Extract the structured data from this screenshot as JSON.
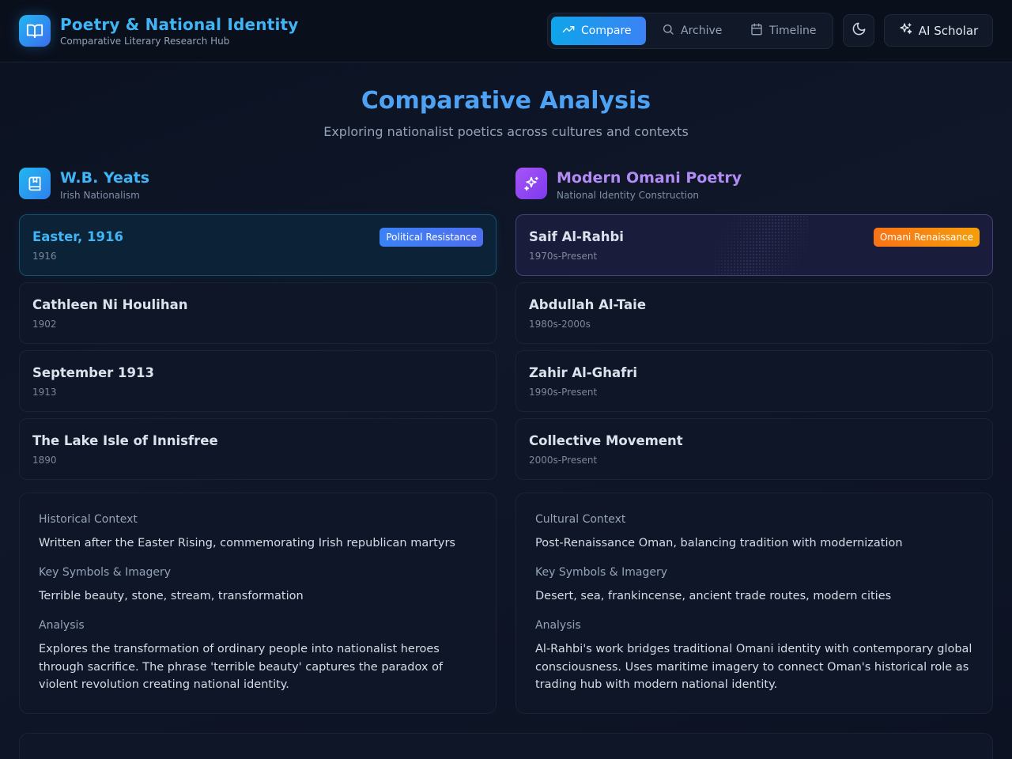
{
  "header": {
    "title": "Poetry & National Identity",
    "subtitle": "Comparative Literary Research Hub",
    "nav": [
      {
        "label": "Compare",
        "icon": "trending-up-icon",
        "active": true
      },
      {
        "label": "Archive",
        "icon": "search-icon",
        "active": false
      },
      {
        "label": "Timeline",
        "icon": "calendar-icon",
        "active": false
      }
    ],
    "theme_icon": "moon-icon",
    "scholar_label": "AI Scholar"
  },
  "page": {
    "title": "Comparative Analysis",
    "subtitle": "Exploring nationalist poetics across cultures and contexts"
  },
  "left": {
    "title": "W.B. Yeats",
    "subtitle": "Irish Nationalism",
    "items": [
      {
        "title": "Easter, 1916",
        "date": "1916",
        "badge": "Political Resistance",
        "selected": true
      },
      {
        "title": "Cathleen Ni Houlihan",
        "date": "1902"
      },
      {
        "title": "September 1913",
        "date": "1913"
      },
      {
        "title": "The Lake Isle of Innisfree",
        "date": "1890"
      }
    ],
    "detail": {
      "context_label": "Historical Context",
      "context_text": "Written after the Easter Rising, commemorating Irish republican martyrs",
      "symbols_label": "Key Symbols & Imagery",
      "symbols_text": "Terrible beauty, stone, stream, transformation",
      "analysis_label": "Analysis",
      "analysis_text": "Explores the transformation of ordinary people into nationalist heroes through sacrifice. The phrase 'terrible beauty' captures the paradox of violent revolution creating national identity."
    }
  },
  "right": {
    "title": "Modern Omani Poetry",
    "subtitle": "National Identity Construction",
    "items": [
      {
        "title": "Saif Al-Rahbi",
        "date": "1970s-Present",
        "badge": "Omani Renaissance",
        "selected": true
      },
      {
        "title": "Abdullah Al-Taie",
        "date": "1980s-2000s"
      },
      {
        "title": "Zahir Al-Ghafri",
        "date": "1990s-Present"
      },
      {
        "title": "Collective Movement",
        "date": "2000s-Present"
      }
    ],
    "detail": {
      "context_label": "Cultural Context",
      "context_text": "Post-Renaissance Oman, balancing tradition with modernization",
      "symbols_label": "Key Symbols & Imagery",
      "symbols_text": "Desert, sea, frankincense, ancient trade routes, modern cities",
      "analysis_label": "Analysis",
      "analysis_text": "Al-Rahbi's work bridges traditional Omani identity with contemporary global consciousness. Uses maritime imagery to connect Oman's historical role as trading hub with modern national identity."
    }
  },
  "colors": {
    "accent_blue": "#3fb5f5",
    "accent_purple": "#b38bf5",
    "badge_blue": "#3b82f6",
    "badge_orange": "#f97316"
  }
}
